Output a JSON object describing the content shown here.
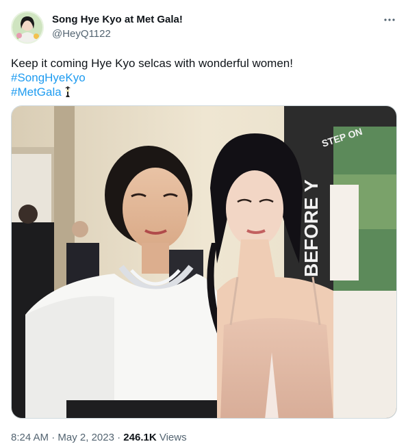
{
  "author": {
    "name": "Song Hye Kyo at Met Gala!",
    "handle": "@HeyQ1122",
    "avatar_icon": "profile-photo"
  },
  "more_icon": "more-horizontal-icon",
  "tweet": {
    "text": "Keep it coming Hye Kyo selcas with wonderful women!",
    "hashtags": [
      "#SongHyeKyo",
      "#MetGala"
    ],
    "emoji_icon": "met-gala-lamp-emoji"
  },
  "media": {
    "poster_text": "BEFORE Y",
    "poster_top_text": "STEP ON"
  },
  "meta": {
    "time": "8:24 AM",
    "sep1": " · ",
    "date": "May 2, 2023",
    "sep2": " · ",
    "views_count": "246.1K",
    "views_label": " Views"
  },
  "colors": {
    "link": "#1d9bf0",
    "text": "#0f1419",
    "secondary": "#536471"
  }
}
